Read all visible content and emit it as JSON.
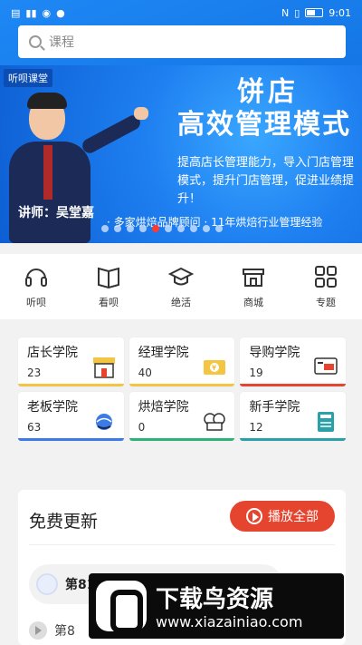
{
  "status_bar": {
    "left_icons": [
      "sim-icon",
      "signal-icon",
      "eye-icon",
      "message-icon"
    ],
    "right_icons": [
      "nfc-icon",
      "vibrate-icon",
      "battery-icon"
    ],
    "time": "9:01"
  },
  "search": {
    "placeholder": "课程"
  },
  "banner": {
    "tag": "听呗课堂",
    "title_line1": "饼店",
    "title_line2": "高效管理模式",
    "description": "提高店长管理能力，导入门店管理模式，提升门店管理，促进业绩提升！",
    "teacher": "讲师：吴堂嘉",
    "resume": "· 多家烘焙品牌顾问 · 11年烘焙行业管理经验",
    "dots_count": 10,
    "active_dot": 4
  },
  "nav": [
    {
      "label": "听呗",
      "icon": "headphones-icon"
    },
    {
      "label": "看呗",
      "icon": "book-icon"
    },
    {
      "label": "绝活",
      "icon": "graduation-cap-icon"
    },
    {
      "label": "商城",
      "icon": "store-icon"
    },
    {
      "label": "专题",
      "icon": "grid-icon"
    }
  ],
  "academies": [
    {
      "title": "店长学院",
      "count": "23",
      "icon": "shop-icon",
      "bar": "#f4c542"
    },
    {
      "title": "经理学院",
      "count": "40",
      "icon": "money-icon",
      "bar": "#f4c542"
    },
    {
      "title": "导购学院",
      "count": "19",
      "icon": "monitor-icon",
      "bar": "#e5452e"
    },
    {
      "title": "老板学院",
      "count": "63",
      "icon": "globe-icon",
      "bar": "#3b7be5"
    },
    {
      "title": "烘焙学院",
      "count": "0",
      "icon": "chef-hat-icon",
      "bar": "#2db37a"
    },
    {
      "title": "新手学院",
      "count": "12",
      "icon": "notebook-icon",
      "bar": "#2aa0a8"
    }
  ],
  "free_updates": {
    "title": "免费更新",
    "play_all": "播放全部",
    "episode": "第81",
    "next": "第8"
  },
  "watermark": {
    "title": "下载鸟资源",
    "url": "www.xiazainiao.com"
  }
}
